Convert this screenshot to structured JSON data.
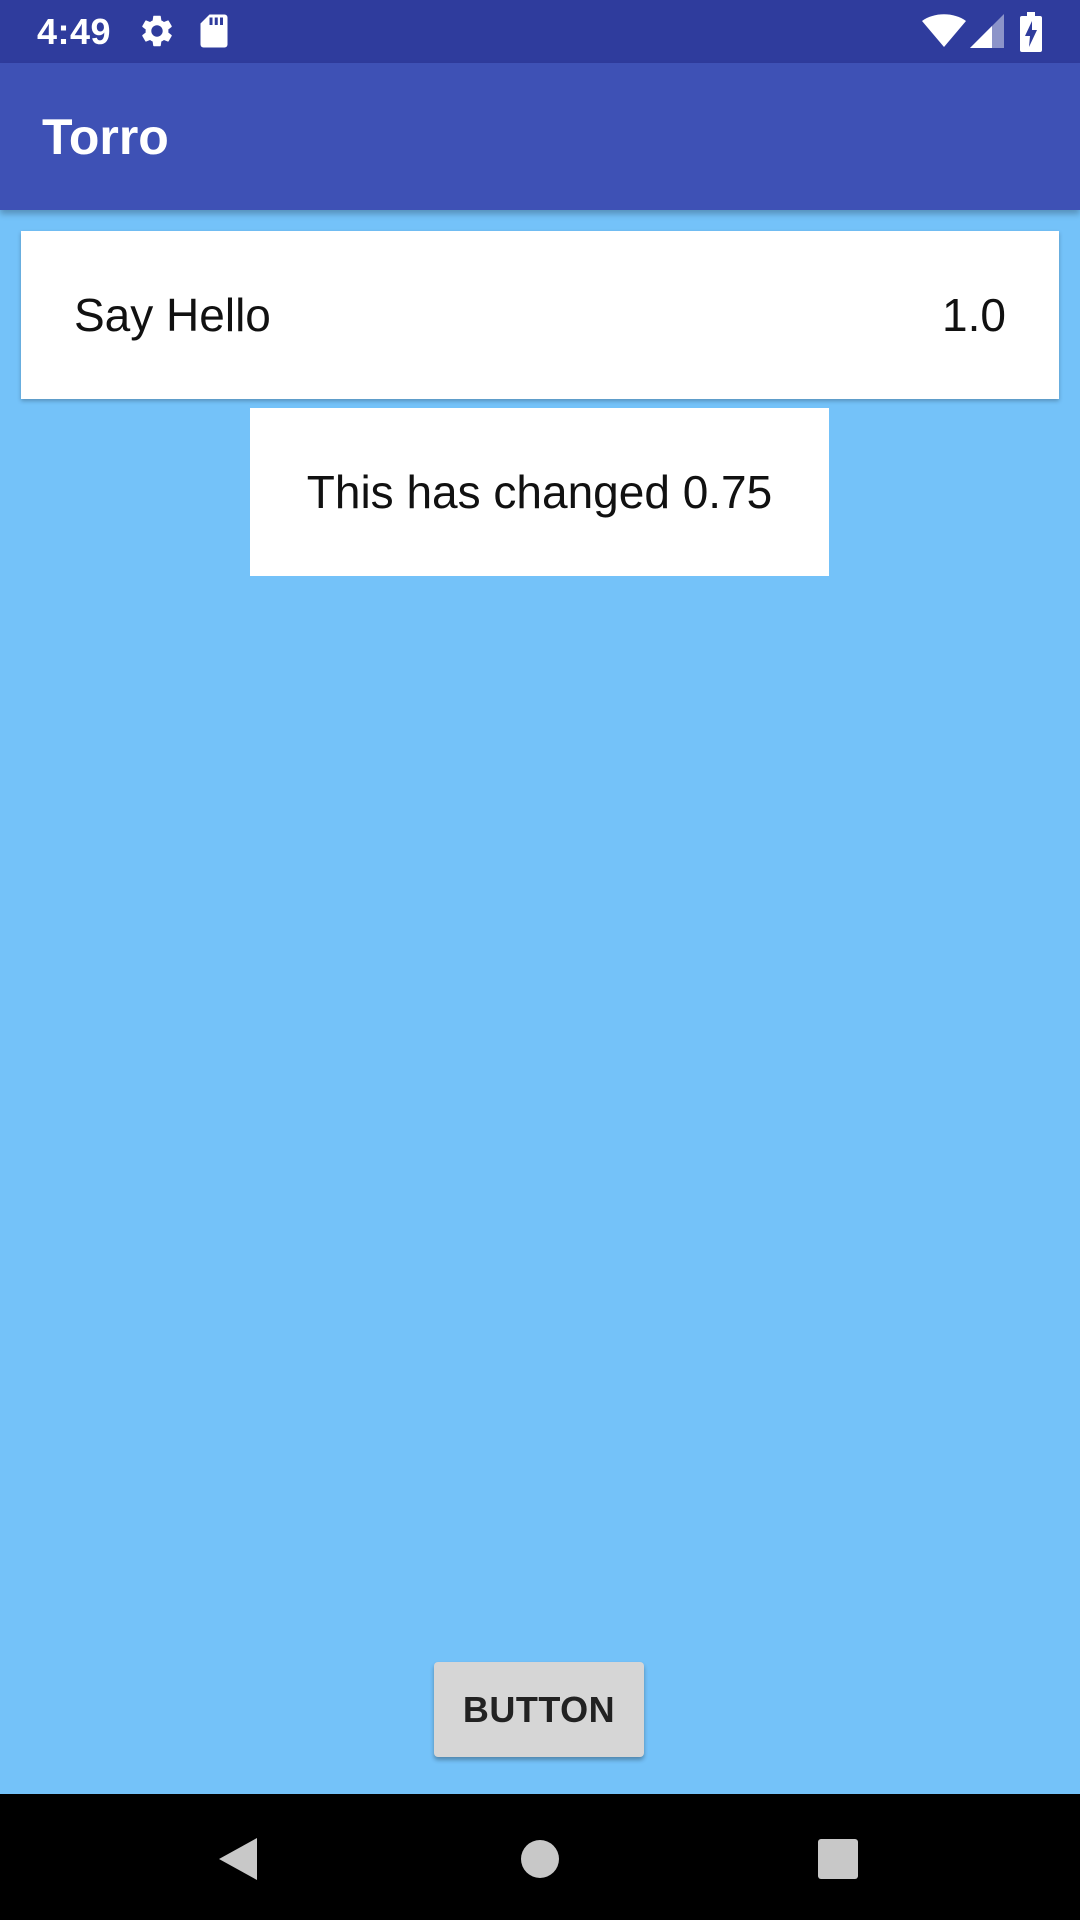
{
  "status_bar": {
    "time": "4:49",
    "icons": [
      "gear-icon",
      "sd-card-icon",
      "wifi-icon",
      "signal-icon",
      "battery-charging-icon"
    ]
  },
  "app_bar": {
    "title": "Torro",
    "color": "#3e51b5"
  },
  "card": {
    "label": "Say Hello",
    "value": "1.0"
  },
  "changed_box": {
    "text": "This has changed 0.75"
  },
  "button": {
    "label": "BUTTON"
  },
  "nav_bar": {
    "icons": [
      "back-icon",
      "home-icon",
      "recents-icon"
    ]
  },
  "colors": {
    "status_bar": "#2f3c9d",
    "background": "#74c2f9",
    "nav_bar": "#000000"
  }
}
